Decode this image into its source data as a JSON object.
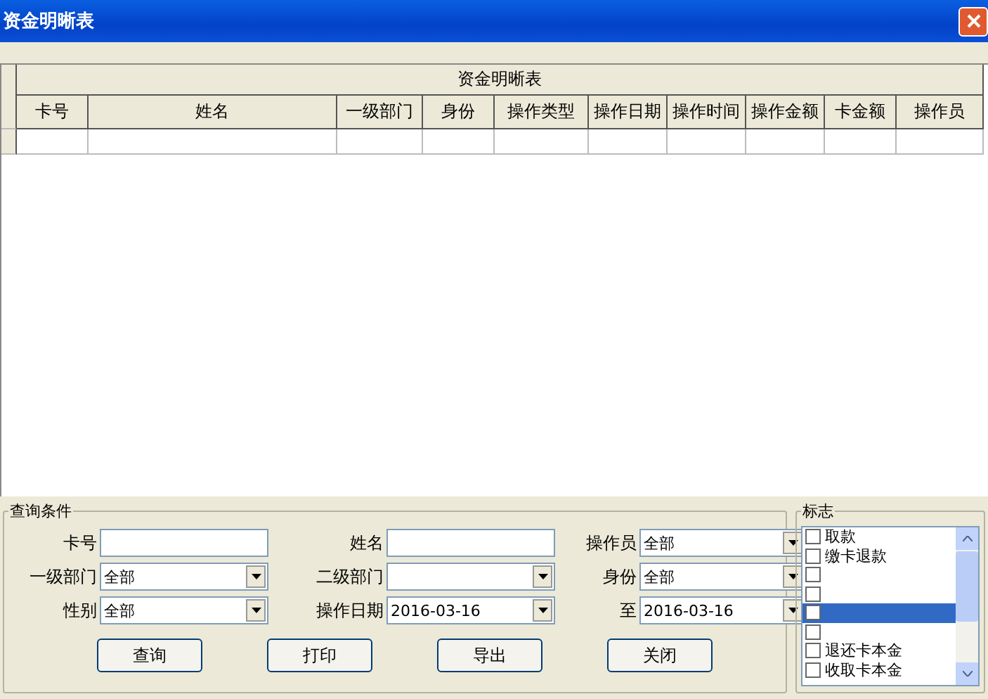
{
  "window": {
    "title": "资金明晰表"
  },
  "table": {
    "title": "资金明晰表",
    "columns": [
      "卡号",
      "姓名",
      "一级部门",
      "身份",
      "操作类型",
      "操作日期",
      "操作时间",
      "操作金额",
      "卡金额",
      "操作员"
    ],
    "rows": [
      [
        "",
        "",
        "",
        "",
        "",
        "",
        "",
        "",
        "",
        ""
      ]
    ]
  },
  "query": {
    "title": "查询条件",
    "fields": [
      {
        "label": "卡号",
        "kind": "text"
      },
      {
        "label": "姓名",
        "kind": "text"
      },
      {
        "label": "操作员",
        "kind": "combo",
        "value": "全部"
      },
      {
        "label": "一级部门",
        "kind": "combo",
        "value": "全部"
      },
      {
        "label": "二级部门",
        "kind": "combo"
      },
      {
        "label": "身份",
        "kind": "combo",
        "value": "全部"
      },
      {
        "label": "性别",
        "kind": "combo",
        "value": "全部"
      },
      {
        "label": "操作日期",
        "kind": "combo",
        "value": "2016-03-16"
      },
      {
        "label": "至",
        "kind": "combo",
        "value": "2016-03-16"
      }
    ],
    "buttons": [
      "查询",
      "打印",
      "导出",
      "关闭"
    ]
  },
  "flags": {
    "title": "标志",
    "items": [
      {
        "label": "取款",
        "checked": false,
        "selected": false
      },
      {
        "label": "缴卡退款",
        "checked": false,
        "selected": false
      },
      {
        "checked": false,
        "selected": false
      },
      {
        "checked": false,
        "selected": false
      },
      {
        "checked": false,
        "selected": true
      },
      {
        "checked": false,
        "selected": false
      },
      {
        "label": "退还卡本金",
        "checked": false,
        "selected": false
      },
      {
        "label": "收取卡本金",
        "checked": false,
        "selected": false
      }
    ]
  }
}
